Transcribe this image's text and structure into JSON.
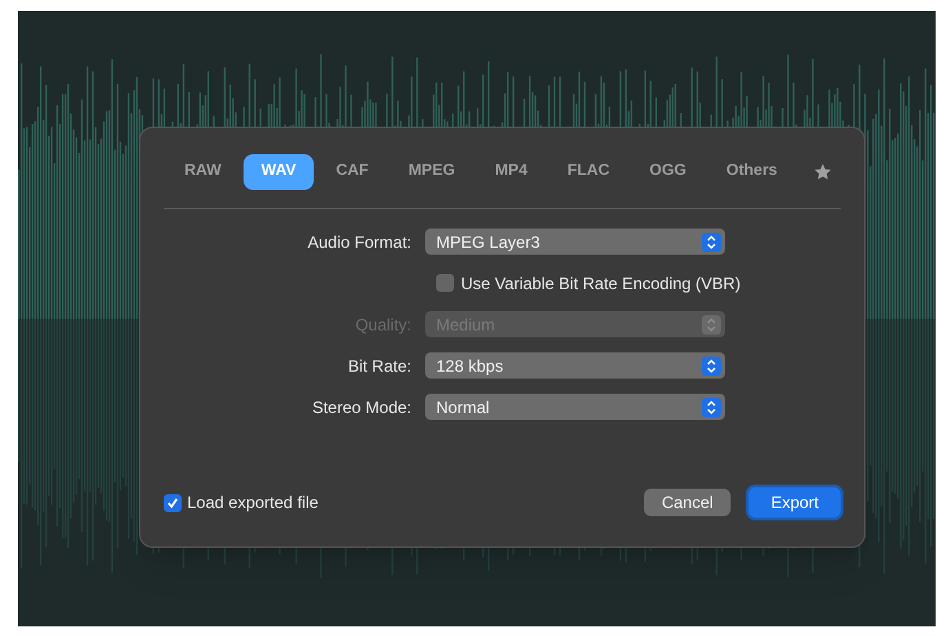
{
  "tabs": [
    {
      "label": "RAW",
      "selected": false
    },
    {
      "label": "WAV",
      "selected": true
    },
    {
      "label": "CAF",
      "selected": false
    },
    {
      "label": "MPEG",
      "selected": false
    },
    {
      "label": "MP4",
      "selected": false
    },
    {
      "label": "FLAC",
      "selected": false
    },
    {
      "label": "OGG",
      "selected": false
    },
    {
      "label": "Others",
      "selected": false
    }
  ],
  "form": [
    {
      "kind": "select",
      "label": "Audio Format:",
      "value": "MPEG Layer3",
      "disabled": false
    },
    {
      "kind": "checkbox",
      "label": "Use Variable Bit Rate Encoding (VBR)",
      "checked": false
    },
    {
      "kind": "select",
      "label": "Quality:",
      "value": "Medium",
      "disabled": true
    },
    {
      "kind": "select",
      "label": "Bit Rate:",
      "value": "128 kbps",
      "disabled": false
    },
    {
      "kind": "select",
      "label": "Stereo Mode:",
      "value": "Normal",
      "disabled": false
    }
  ],
  "load_exported": {
    "label": "Load exported file",
    "checked": true
  },
  "buttons": [
    {
      "label": "Cancel",
      "kind": "secondary"
    },
    {
      "label": "Export",
      "kind": "primary"
    }
  ]
}
